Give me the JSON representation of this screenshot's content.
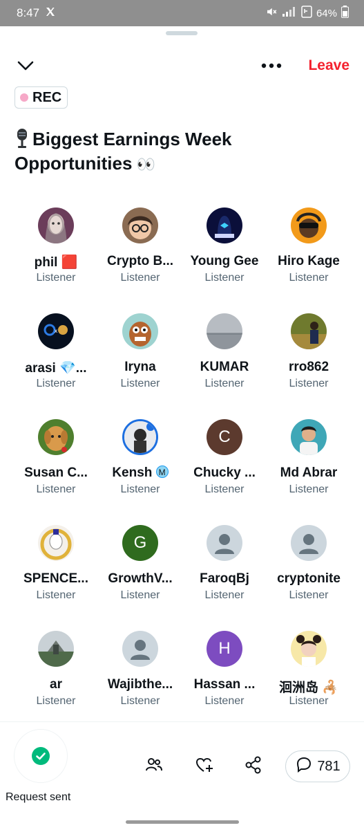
{
  "status_bar": {
    "time": "8:47",
    "app_icon": "x-logo-icon",
    "battery": "64%"
  },
  "header": {
    "leave_label": "Leave",
    "rec_label": "REC"
  },
  "space": {
    "title_line1": "Biggest Earnings Week",
    "title_line2": "Opportunities",
    "title_emoji": "👀"
  },
  "participants": [
    {
      "name": "phil 🟥",
      "role": "Listener"
    },
    {
      "name": "Crypto B...",
      "role": "Listener"
    },
    {
      "name": "Young Gee",
      "role": "Listener"
    },
    {
      "name": "Hiro Kage",
      "role": "Listener"
    },
    {
      "name": "arasi 💎...",
      "role": "Listener"
    },
    {
      "name": "Iryna",
      "role": "Listener"
    },
    {
      "name": "KUMAR",
      "role": "Listener"
    },
    {
      "name": "rro862",
      "role": "Listener"
    },
    {
      "name": "Susan C...",
      "role": "Listener"
    },
    {
      "name": "Kensh",
      "role": "Listener",
      "badge": "M"
    },
    {
      "name": "Chucky ...",
      "role": "Listener",
      "avatar_letter": "C"
    },
    {
      "name": "Md Abrar",
      "role": "Listener"
    },
    {
      "name": "SPENCE...",
      "role": "Listener"
    },
    {
      "name": "GrowthV...",
      "role": "Listener",
      "avatar_letter": "G"
    },
    {
      "name": "FaroqBj",
      "role": "Listener"
    },
    {
      "name": "cryptonite",
      "role": "Listener"
    },
    {
      "name": "ar",
      "role": "Listener"
    },
    {
      "name": "Wajibthe...",
      "role": "Listener"
    },
    {
      "name": "Hassan ...",
      "role": "Listener",
      "avatar_letter": "H"
    },
    {
      "name": "洄洲岛 🦂",
      "role": "Listener"
    }
  ],
  "bottom_bar": {
    "request_label": "Request sent",
    "comment_count": "781"
  },
  "colors": {
    "leave": "#f4212e",
    "accent_green": "#00ba7c",
    "muted": "#536471"
  }
}
